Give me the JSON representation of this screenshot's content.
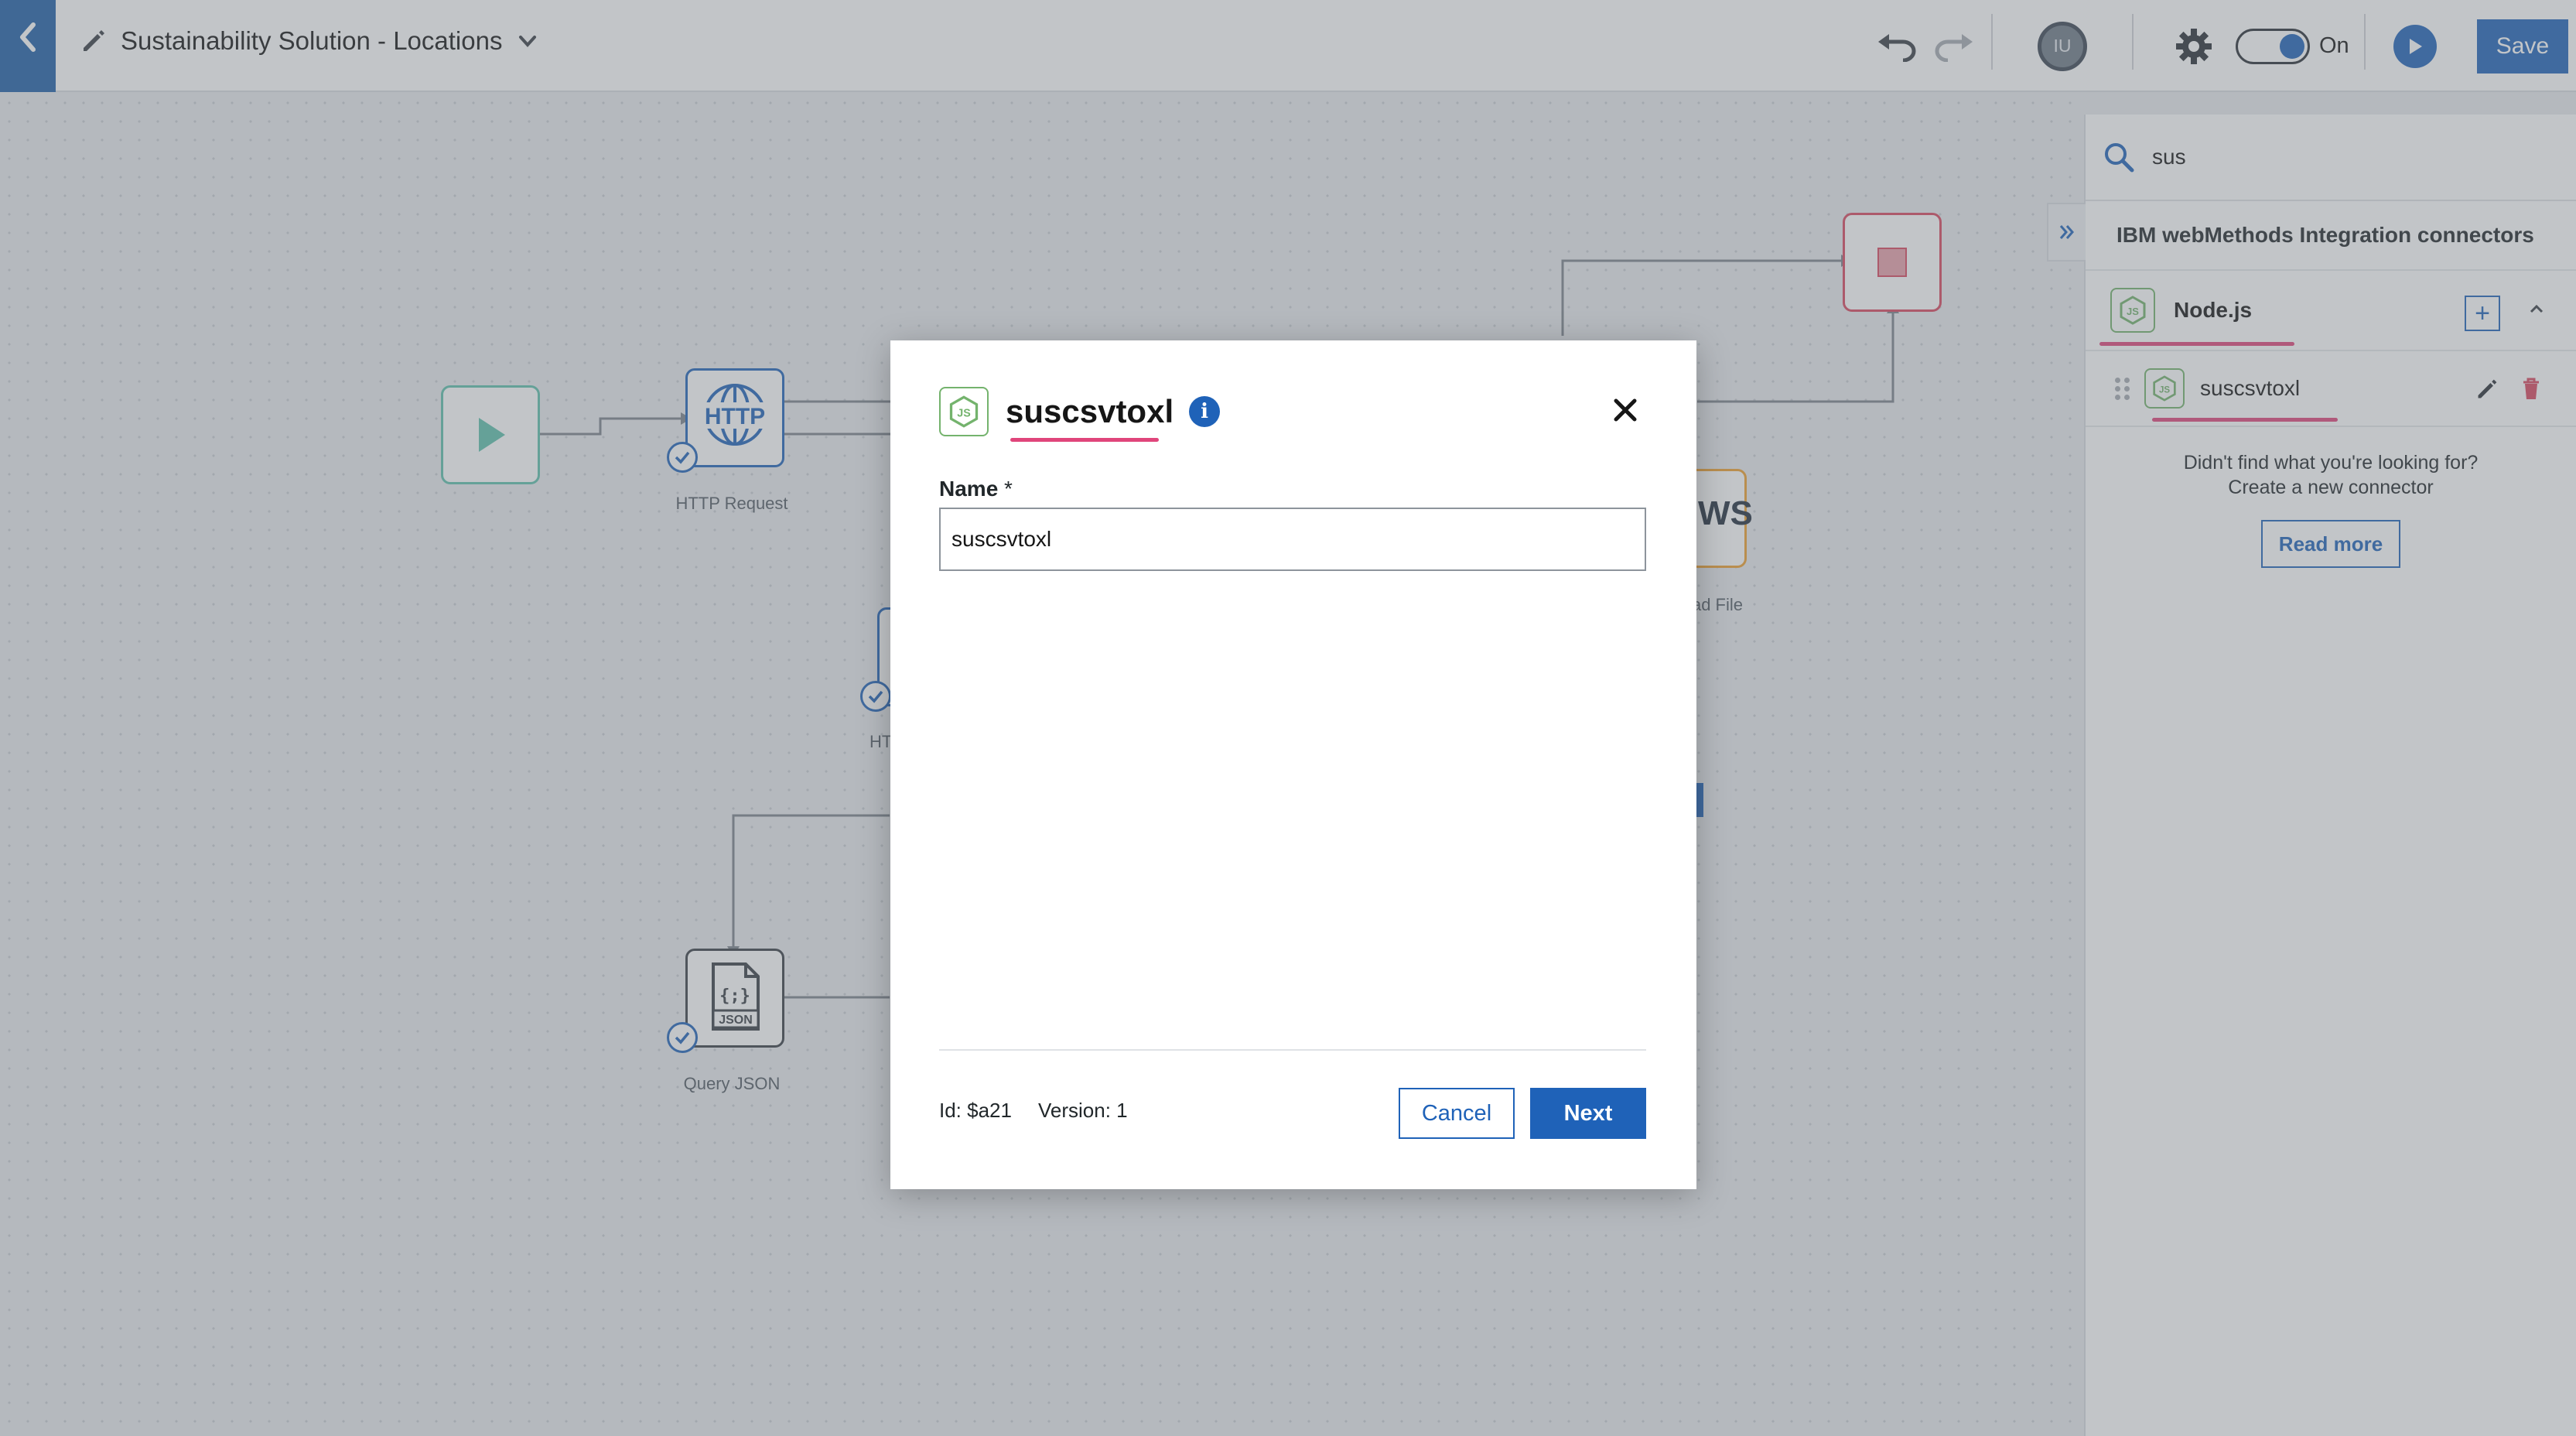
{
  "header": {
    "title": "Sustainability Solution - Locations",
    "toggle_label": "On",
    "avatar_initials": "IU",
    "save_label": "Save"
  },
  "canvas": {
    "nodes": [
      {
        "id": "start",
        "label": ""
      },
      {
        "id": "http",
        "label": "HTTP Request",
        "icon_text": "HTTP"
      },
      {
        "id": "aws",
        "label": "ad File",
        "icon_text": "WS"
      },
      {
        "id": "json",
        "label": "Query JSON",
        "icon_text": "JSON"
      },
      {
        "id": "partial",
        "label": "HT"
      }
    ]
  },
  "side_panel": {
    "search_value": "sus",
    "section_title": "IBM webMethods Integration connectors",
    "group_label": "Node.js",
    "item_label": "suscsvtoxl",
    "not_found_line1": "Didn't find what you're looking for?",
    "not_found_line2": "Create a new connector",
    "read_more_label": "Read more"
  },
  "modal": {
    "title": "suscsvtoxl",
    "name_label": "Name",
    "required_marker": "*",
    "name_value": "suscsvtoxl",
    "id_text": "Id: $a21",
    "version_text": "Version: 1",
    "cancel_label": "Cancel",
    "next_label": "Next"
  },
  "colors": {
    "primary": "#1f62b8",
    "highlight_underline": "#e0457b",
    "node_green": "#74b36d",
    "stop_red": "#d9485f"
  }
}
